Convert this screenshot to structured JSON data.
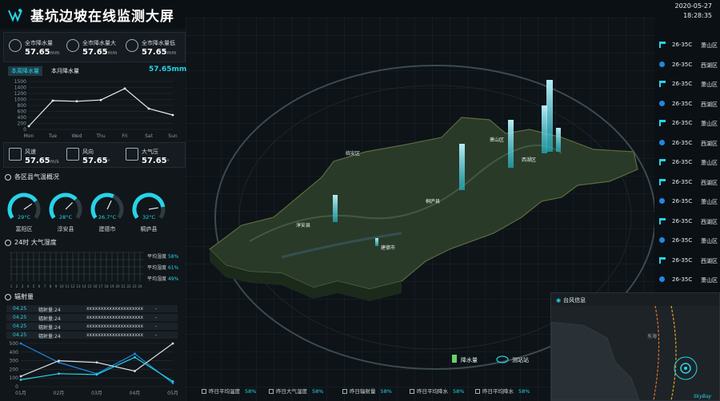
{
  "header": {
    "title": "基坑边坡在线监测大屏",
    "date": "2020-05-27",
    "time": "18:28:35"
  },
  "rain_stats": [
    {
      "label": "全市降水量",
      "value": "57.65",
      "unit": "mm"
    },
    {
      "label": "全市降水量大",
      "value": "57.65",
      "unit": "mm"
    },
    {
      "label": "全市降水量低",
      "value": "57.65",
      "unit": "mm"
    }
  ],
  "rain_tabs": {
    "week": "本周降水量",
    "month": "本月降水量",
    "total": "57.65mm"
  },
  "chart_data": [
    {
      "type": "line",
      "categories": [
        "Mon",
        "Tue",
        "Wed",
        "Thu",
        "Fri",
        "Sat",
        "Sun"
      ],
      "series": [
        {
          "values": [
            100,
            900,
            880,
            920,
            1280,
            650,
            450
          ]
        }
      ],
      "yticks": [
        "0",
        "200",
        "400",
        "600",
        "800",
        "1000",
        "1200",
        "1400",
        "1500"
      ],
      "ylim": [
        0,
        1500
      ],
      "grid": true
    },
    {
      "type": "line",
      "categories": [
        "01月",
        "02月",
        "03月",
        "04月",
        "05月"
      ],
      "series": [
        {
          "values": [
            500,
            280,
            150,
            380,
            40
          ]
        },
        {
          "values": [
            120,
            300,
            280,
            180,
            500
          ]
        },
        {
          "values": [
            80,
            150,
            140,
            340,
            60
          ]
        }
      ],
      "colors": [
        "#1e88e5",
        "#e0e0e0",
        "#27d3e8"
      ],
      "yticks": [
        "0",
        "100",
        "200",
        "300",
        "400",
        "500"
      ],
      "ylim": [
        0,
        500
      ],
      "grid": true
    }
  ],
  "weather": [
    {
      "label": "风速",
      "value": "57.65",
      "unit": "m/s"
    },
    {
      "label": "风向",
      "value": "57.65",
      "unit": "°"
    },
    {
      "label": "大气压",
      "value": "57.65",
      "unit": "°"
    }
  ],
  "temp_section": {
    "title": "各区县气温概况",
    "items": [
      {
        "name": "富阳区",
        "value": "29°C",
        "level": 0.72
      },
      {
        "name": "淳安县",
        "value": "28°C",
        "level": 0.68
      },
      {
        "name": "建德市",
        "value": "26.7°C",
        "level": 0.6
      },
      {
        "name": "桐庐县",
        "value": "32°C",
        "level": 0.82
      }
    ]
  },
  "humidity": {
    "title": "24时 大气湿度",
    "ticks": [
      "1",
      "2",
      "3",
      "4",
      "5",
      "6",
      "7",
      "8",
      "9",
      "10",
      "11",
      "12",
      "13",
      "14",
      "15",
      "16",
      "17",
      "18",
      "19",
      "20",
      "21",
      "22",
      "23",
      "24"
    ],
    "badges": [
      {
        "label": "平均湿度",
        "value": "58%"
      },
      {
        "label": "平均湿度",
        "value": "61%"
      },
      {
        "label": "平均湿度",
        "value": "49%"
      }
    ]
  },
  "radiation": {
    "title": "辐射量",
    "rows": [
      {
        "date": "04.25",
        "label": "辐射量:24",
        "text": "xxxxxxxxxxxxxxxxxxxx",
        "dash": "-"
      },
      {
        "date": "04.25",
        "label": "辐射量:24",
        "text": "xxxxxxxxxxxxxxxxxxxx",
        "dash": "-"
      },
      {
        "date": "04.25",
        "label": "辐射量:24",
        "text": "xxxxxxxxxxxxxxxxxxxx",
        "dash": "-"
      },
      {
        "date": "04.25",
        "label": "辐射量:24",
        "text": "xxxxxxxxxxxxxxxxxxxx",
        "dash": "-"
      }
    ]
  },
  "map": {
    "labels": [
      "临安区",
      "西湖区",
      "萧山区",
      "桐庐县",
      "淳安县",
      "建德市"
    ],
    "legend": {
      "rain": "降水量",
      "station": "测站站"
    }
  },
  "right_list": [
    {
      "type": "flag",
      "temp": "26-35C",
      "district": "萧山区"
    },
    {
      "type": "dot",
      "temp": "26-35C",
      "district": "西湖区"
    },
    {
      "type": "flag",
      "temp": "26-35C",
      "district": "萧山区"
    },
    {
      "type": "dot",
      "temp": "26-35C",
      "district": "西湖区"
    },
    {
      "type": "flag",
      "temp": "26-35C",
      "district": "萧山区"
    },
    {
      "type": "dot",
      "temp": "26-35C",
      "district": "西湖区"
    },
    {
      "type": "flag",
      "temp": "26-35C",
      "district": "萧山区"
    },
    {
      "type": "flag",
      "temp": "26-35C",
      "district": "西湖区"
    },
    {
      "type": "dot",
      "temp": "26-35C",
      "district": "萧山区"
    },
    {
      "type": "flag",
      "temp": "26-35C",
      "district": "西湖区"
    },
    {
      "type": "dot",
      "temp": "26-35C",
      "district": "萧山区"
    },
    {
      "type": "flag",
      "temp": "26-35C",
      "district": "西湖区"
    },
    {
      "type": "dot",
      "temp": "26-35C",
      "district": "萧山区"
    }
  ],
  "typhoon": {
    "title": "台风信息",
    "sea": "东海",
    "logo": "SkyBay"
  },
  "bottom_stats": [
    {
      "label": "昨日平均温度",
      "value": "58%"
    },
    {
      "label": "昨日大气湿度",
      "value": "58%"
    },
    {
      "label": "昨日辐射量",
      "value": "58%"
    },
    {
      "label": "昨日平均降水",
      "value": "58%"
    },
    {
      "label": "昨日平均降水",
      "value": "58%"
    }
  ],
  "colors": {
    "accent": "#27d3e8",
    "bg": "#0b1014",
    "panel": "#151b20"
  }
}
